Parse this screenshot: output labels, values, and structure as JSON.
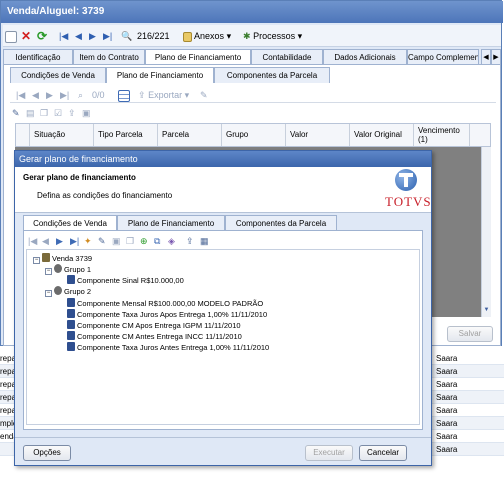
{
  "back_window": {
    "title": "Venda/Aluguel: 3739",
    "toolbar": {
      "record_counter": "216/221",
      "anexos": "Anexos",
      "processos": "Processos"
    },
    "tabs": [
      "Identificação",
      "Item do Contrato",
      "Plano de Financiamento",
      "Contabilidade",
      "Dados Adicionais",
      "Campo Complemen"
    ],
    "subtabs": [
      "Condições de Venda",
      "Plano de Financiamento",
      "Componentes da Parcela"
    ],
    "subtoolbar": {
      "counter": "0/0",
      "exportar": "Exportar"
    },
    "grid_columns": [
      "Situação",
      "Tipo Parcela",
      "Parcela",
      "Grupo",
      "Valor",
      "Valor Original",
      "Vencimento (1)"
    ],
    "buttons": {
      "salvar": "Salvar"
    }
  },
  "background_rows": [
    {
      "left": "repar",
      "right": "Saara"
    },
    {
      "left": "repar",
      "right": "Saara"
    },
    {
      "left": "repar",
      "right": "Saara"
    },
    {
      "left": "repar",
      "right": "Saara"
    },
    {
      "left": "repar",
      "right": "Saara"
    },
    {
      "left": "mpléi",
      "right": "Saara"
    },
    {
      "left": "enda",
      "right": "Saara"
    },
    {
      "left": "",
      "right": "Saara"
    }
  ],
  "dialog": {
    "title": "Gerar plano de financiamento",
    "header_title": "Gerar plano de financiamento",
    "header_subtitle": "Defina as condições do financiamento",
    "logo_text": "TOTVS",
    "tabs": [
      "Condições de Venda",
      "Plano de Financiamento",
      "Componentes da Parcela"
    ],
    "tree": {
      "root": "Venda 3739",
      "groups": [
        {
          "label": "Grupo 1",
          "items": [
            "Componente Sinal  R$10.000,00"
          ]
        },
        {
          "label": "Grupo 2",
          "items": [
            "Componente Mensal  R$100.000,00  MODELO PADRÃO",
            "Componente Taxa Juros Apos Entrega 1,00%    11/11/2010",
            "Componente CM Apos Entrega    IGPM  11/11/2010",
            "Componente CM Antes Entrega    INCC  11/11/2010",
            "Componente Taxa Juros Antes Entrega 1,00%    11/11/2010"
          ]
        }
      ]
    },
    "buttons": {
      "opcoes": "Opções",
      "executar": "Executar",
      "cancelar": "Cancelar"
    }
  },
  "colors": {
    "titlebar": "#4d75b9",
    "window_bg": "#dfe8f6",
    "grid_empty": "#808080",
    "logo_red": "#c8202a"
  }
}
